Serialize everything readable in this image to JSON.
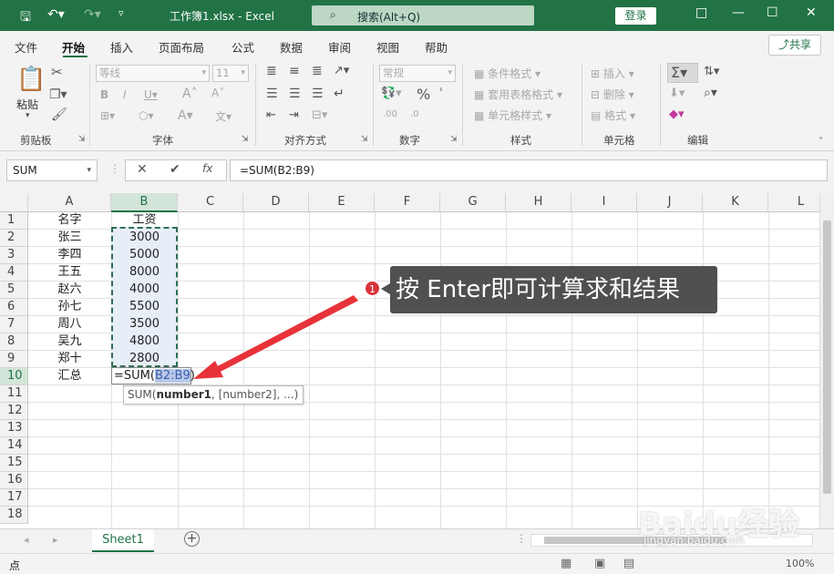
{
  "titlebar": {
    "title": "工作簿1.xlsx  -  Excel",
    "search": "搜索(Alt+Q)",
    "login": "登录"
  },
  "menu": {
    "items": [
      "文件",
      "开始",
      "插入",
      "页面布局",
      "公式",
      "数据",
      "审阅",
      "视图",
      "帮助"
    ],
    "active": "开始",
    "share": "共享"
  },
  "ribbon": {
    "clipboard": {
      "label": "剪贴板",
      "paste": "粘贴"
    },
    "font": {
      "label": "字体",
      "font_name": "等线",
      "font_size": "11"
    },
    "alignment": {
      "label": "对齐方式"
    },
    "number": {
      "label": "数字",
      "format": "常规"
    },
    "styles": {
      "label": "样式",
      "conditional": "条件格式",
      "table": "套用表格格式",
      "cell": "单元格样式"
    },
    "cells": {
      "label": "单元格",
      "insert": "插入",
      "delete": "删除",
      "format": "格式"
    },
    "editing": {
      "label": "编辑"
    }
  },
  "formula_bar": {
    "name_box": "SUM",
    "formula": "=SUM(B2:B9)",
    "fx": "fx"
  },
  "grid": {
    "columns": [
      "A",
      "B",
      "C",
      "D",
      "E",
      "F",
      "G",
      "H",
      "I",
      "J",
      "K",
      "L"
    ],
    "rows": [
      "1",
      "2",
      "3",
      "4",
      "5",
      "6",
      "7",
      "8",
      "9",
      "10",
      "11",
      "12",
      "13",
      "14",
      "15",
      "16",
      "17",
      "18"
    ],
    "names": [
      "名字",
      "张三",
      "李四",
      "王五",
      "赵六",
      "孙七",
      "周八",
      "吴九",
      "郑十",
      "汇总"
    ],
    "salaries": [
      "工资",
      "3000",
      "5000",
      "8000",
      "4000",
      "5500",
      "3500",
      "4800",
      "2800"
    ],
    "active_cell_prefix": "=SUM(",
    "active_cell_range": "B2:B9",
    "active_cell_suffix": ")",
    "tooltip_fn": "SUM(",
    "tooltip_bold": "number1",
    "tooltip_rest": ", [number2], ...)"
  },
  "callout": {
    "number": "1",
    "text": "按 Enter即可计算求和结果",
    "bg_color": "#505050",
    "arrow_color": "#e8323a"
  },
  "sheets": {
    "tabs": [
      "Sheet1"
    ],
    "add": "+"
  },
  "status": {
    "mode": "点",
    "zoom": "100%"
  },
  "watermark": {
    "logo": "Baidu经验",
    "url": "jingyan.baidu.com"
  },
  "colors": {
    "accent": "#217346",
    "selection": "#2f6e52"
  }
}
